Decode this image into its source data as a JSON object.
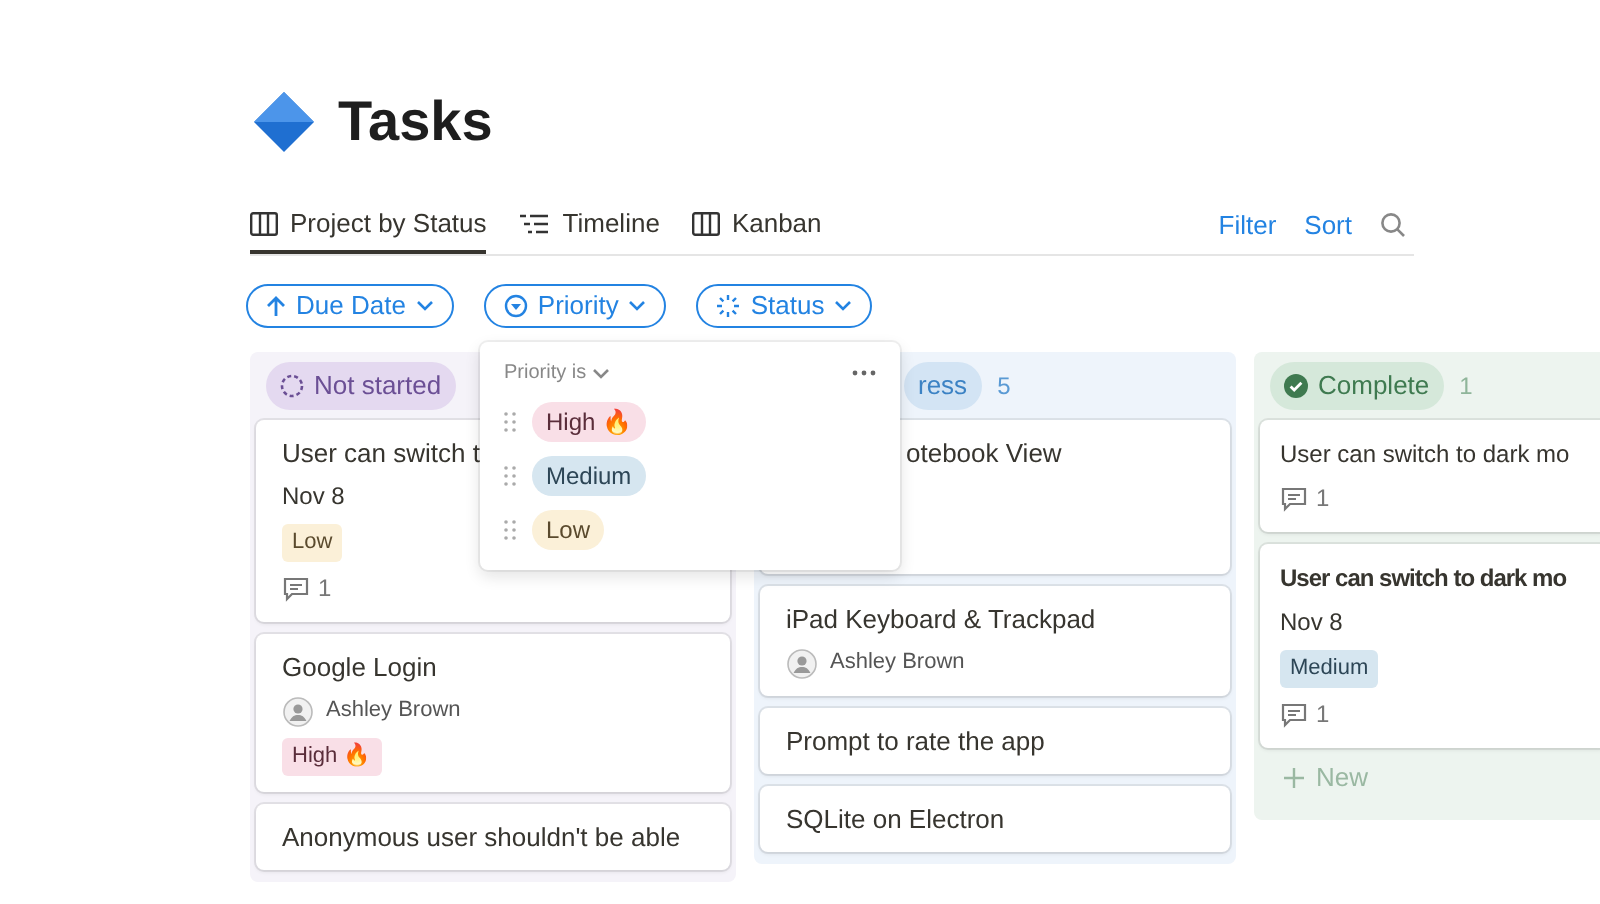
{
  "page": {
    "title": "Tasks"
  },
  "tabs": [
    {
      "label": "Project by Status",
      "selected": true
    },
    {
      "label": "Timeline",
      "selected": false
    },
    {
      "label": "Kanban",
      "selected": false
    }
  ],
  "actions": [
    "Filter",
    "Sort"
  ],
  "filters": [
    {
      "label": "Due Date"
    },
    {
      "label": "Priority"
    },
    {
      "label": "Status"
    }
  ],
  "columns": [
    {
      "kind": "not_started",
      "name": "Not started",
      "cards": [
        {
          "title": "User can switch t",
          "covered": false,
          "bold": false,
          "date": "Nov 8",
          "tag": {
            "label": "Low",
            "kind": "low"
          },
          "comments": "1"
        },
        {
          "title": "Google Login",
          "covered": false,
          "bold": false,
          "assignee": "Ashley Brown",
          "tag": {
            "label": "High 🔥",
            "kind": "high"
          }
        },
        {
          "title": "Anonymous user shouldn't be able",
          "covered": false,
          "bold": false
        }
      ]
    },
    {
      "kind": "in_progress",
      "name": "ress",
      "count": "5",
      "cards": [
        {
          "title": "otebook View",
          "covered": true,
          "bold": false
        },
        {
          "title": "iPad Keyboard & Trackpad",
          "covered": false,
          "bold": false,
          "assignee": "Ashley Brown"
        },
        {
          "title": "Prompt to rate the app",
          "covered": false,
          "bold": false
        },
        {
          "title": "SQLite on Electron",
          "covered": false,
          "bold": false
        }
      ]
    },
    {
      "kind": "complete",
      "name": "Complete",
      "count": "1",
      "cards": [
        {
          "title": "User can switch to dark mo",
          "covered": false,
          "bold": false,
          "comments": "1"
        },
        {
          "title": "User can switch to dark mo",
          "covered": false,
          "bold": true,
          "date": "Nov 8",
          "tag": {
            "label": "Medium",
            "kind": "medium"
          },
          "comments": "1"
        }
      ],
      "new": "New"
    }
  ],
  "dropdown": {
    "title": "Priority is",
    "options": [
      {
        "label": "High 🔥",
        "kind": "high"
      },
      {
        "label": "Medium",
        "kind": "medium"
      },
      {
        "label": "Low",
        "kind": "low"
      }
    ]
  }
}
